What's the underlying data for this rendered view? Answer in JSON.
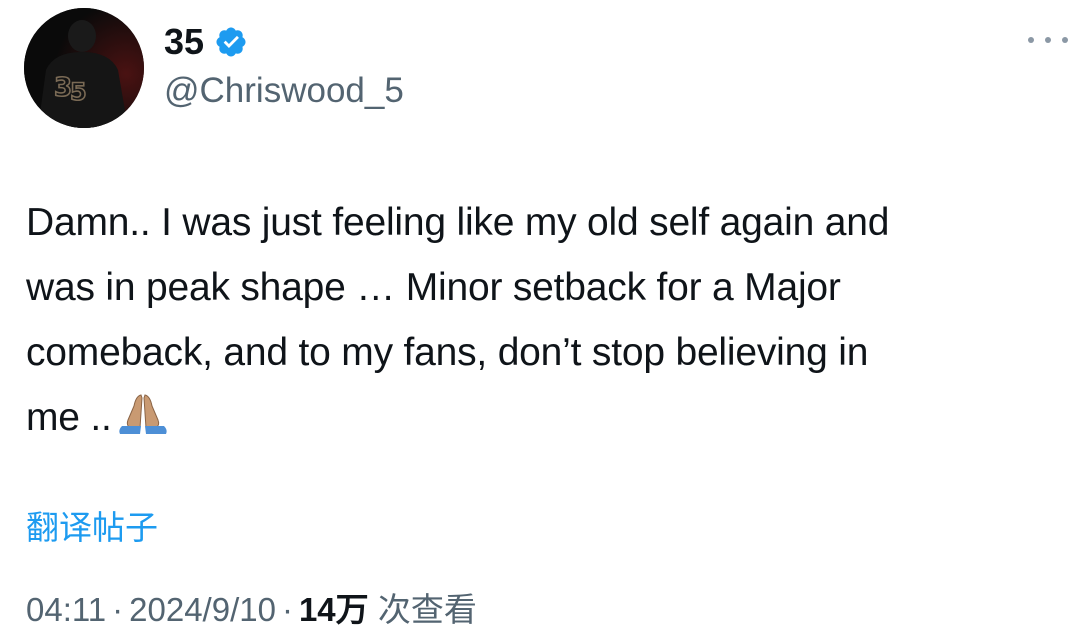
{
  "author": {
    "display_name": "35",
    "handle": "@Chriswood_5",
    "verified_icon": "verified-badge-icon",
    "verified_color": "#1d9bf0"
  },
  "more_icon": "more-horizontal-icon",
  "tweet": {
    "lines": [
      "Damn.. I was just feeling like my old self again and",
      "was in peak shape … Minor setback for a Major",
      "comeback, and to my fans, don’t stop believing in",
      "me .."
    ],
    "emoji": "folded-hands-icon"
  },
  "translate_label": "翻译帖子",
  "meta": {
    "time": "04:11",
    "separator": "·",
    "date": "2024/9/10",
    "views_count": "14万",
    "views_label": "次查看"
  },
  "colors": {
    "link": "#1d9bf0",
    "secondary_text": "#536471",
    "primary_text": "#0f1419"
  }
}
